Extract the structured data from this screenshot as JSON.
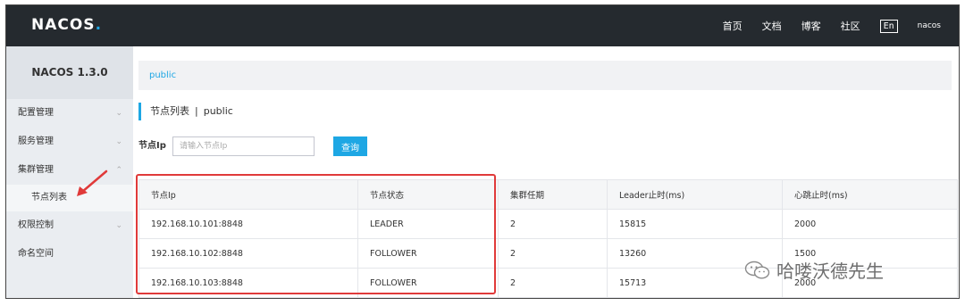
{
  "header": {
    "logo_text": "NACOS",
    "nav": [
      "首页",
      "文档",
      "博客",
      "社区"
    ],
    "lang": "En",
    "user": "nacos"
  },
  "sidebar": {
    "title": "NACOS 1.3.0",
    "items": [
      {
        "label": "配置管理",
        "chevron": "chevron-down-icon"
      },
      {
        "label": "服务管理",
        "chevron": "chevron-down-icon"
      },
      {
        "label": "集群管理",
        "chevron": "chevron-up-icon"
      },
      {
        "label": "节点列表"
      },
      {
        "label": "权限控制",
        "chevron": "chevron-down-icon"
      },
      {
        "label": "命名空间"
      }
    ]
  },
  "main": {
    "breadcrumb": "public",
    "title": "节点列表",
    "title_sep": "|",
    "namespace": "public",
    "filter_label": "节点Ip",
    "filter_placeholder": "请输入节点Ip",
    "query_button": "查询"
  },
  "table": {
    "columns": [
      "节点Ip",
      "节点状态",
      "集群任期",
      "Leader止时(ms)",
      "心跳止时(ms)"
    ],
    "rows": [
      [
        "192.168.10.101:8848",
        "LEADER",
        "2",
        "15815",
        "2000"
      ],
      [
        "192.168.10.102:8848",
        "FOLLOWER",
        "2",
        "13260",
        "1500"
      ],
      [
        "192.168.10.103:8848",
        "FOLLOWER",
        "2",
        "15713",
        "2000"
      ]
    ]
  },
  "watermark": "哈喽沃德先生",
  "colors": {
    "accent": "#1ea7e4",
    "header_bg": "#252a2f",
    "sidebar_bg": "#eaedf1",
    "highlight": "#e03a3a"
  }
}
